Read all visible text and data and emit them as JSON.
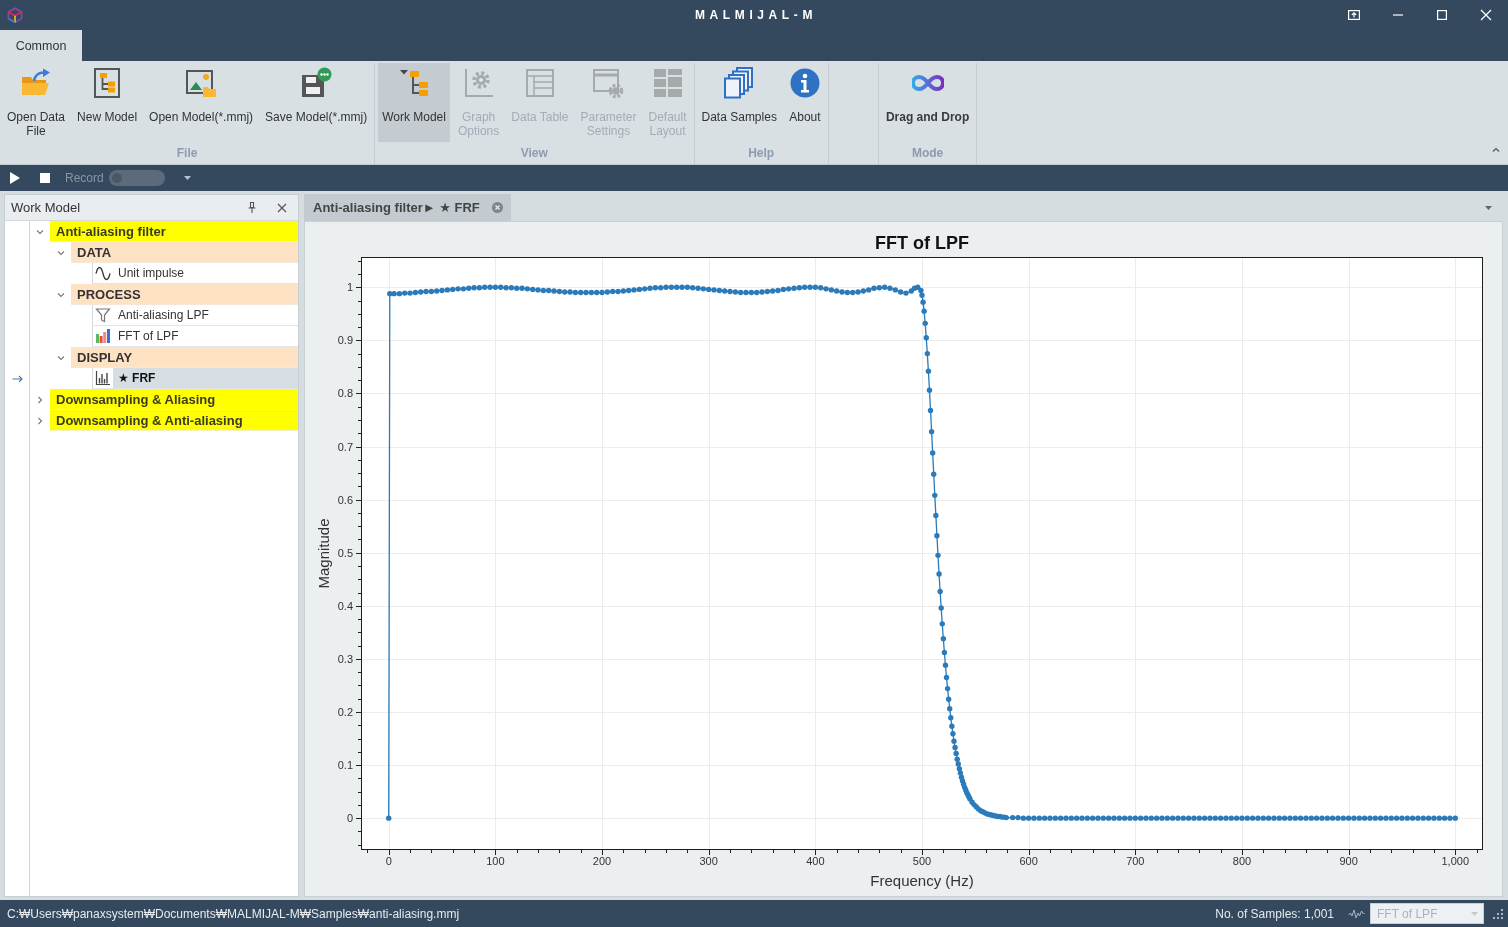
{
  "window": {
    "title": "MALMIJAL-M"
  },
  "ribbon": {
    "tabs": [
      {
        "label": "Common",
        "selected": true
      }
    ],
    "groups": [
      {
        "label": "File",
        "buttons": [
          {
            "label": "Open Data\nFile",
            "kind": "command",
            "on": false,
            "disabled": false
          },
          {
            "label": "New Model",
            "kind": "command",
            "on": false,
            "disabled": false
          },
          {
            "label": "Open Model(*.mmj)",
            "kind": "command",
            "on": false,
            "disabled": false
          },
          {
            "label": "Save Model(*.mmj)",
            "kind": "command",
            "on": false,
            "disabled": false
          }
        ]
      },
      {
        "label": "View",
        "buttons": [
          {
            "label": "Work Model",
            "kind": "command",
            "on": true,
            "disabled": false
          },
          {
            "label": "Graph\nOptions",
            "kind": "command",
            "on": false,
            "disabled": true
          },
          {
            "label": "Data Table",
            "kind": "command",
            "on": false,
            "disabled": true
          },
          {
            "label": "Parameter\nSettings",
            "kind": "command",
            "on": false,
            "disabled": true
          },
          {
            "label": "Default\nLayout",
            "kind": "command",
            "on": false,
            "disabled": true
          }
        ]
      },
      {
        "label": "Help",
        "buttons": [
          {
            "label": "Data Samples",
            "kind": "command",
            "on": false,
            "disabled": false
          },
          {
            "label": "About",
            "kind": "command",
            "on": false,
            "disabled": false
          }
        ]
      },
      {
        "label": "Mode",
        "buttons": [
          {
            "label": "Drag and Drop",
            "kind": "mode",
            "on": false,
            "disabled": false
          }
        ]
      }
    ]
  },
  "toolbar": {
    "record": {
      "label": "Record",
      "disabled": true,
      "on": false
    }
  },
  "work_model": {
    "title": "Work Model",
    "tree": [
      {
        "label": "Anti-aliasing filter",
        "kind": "model",
        "expanded": true,
        "selected": false,
        "children": [
          {
            "label": "DATA",
            "kind": "category",
            "expanded": true,
            "selected": false,
            "children": [
              {
                "label": "Unit impulse",
                "kind": "signal",
                "selected": false
              }
            ]
          },
          {
            "label": "PROCESS",
            "kind": "category",
            "expanded": true,
            "selected": false,
            "children": [
              {
                "label": "Anti-aliasing LPF",
                "kind": "filter",
                "selected": false
              },
              {
                "label": "FFT of LPF",
                "kind": "spectrum",
                "selected": false
              }
            ]
          },
          {
            "label": "DISPLAY",
            "kind": "category",
            "expanded": true,
            "selected": false,
            "children": [
              {
                "label": "★ FRF",
                "kind": "plot",
                "selected": true
              }
            ]
          }
        ]
      },
      {
        "label": "Downsampling & Aliasing",
        "kind": "model",
        "expanded": false,
        "selected": false
      },
      {
        "label": "Downsampling & Anti-aliasing",
        "kind": "model",
        "expanded": false,
        "selected": false
      }
    ]
  },
  "document": {
    "tabs": [
      {
        "label": "Anti-aliasing filter► ★ FRF",
        "selected": true
      }
    ],
    "chart_data": {
      "type": "line",
      "title": "FFT of LPF",
      "xlabel": "Frequency (Hz)",
      "ylabel": "Magnitude",
      "xlim": [
        -26,
        1026
      ],
      "ylim": [
        -0.06,
        1.057
      ],
      "grid": true,
      "xticks": [
        0,
        100,
        200,
        300,
        400,
        500,
        600,
        700,
        800,
        900,
        {
          "value": 1000,
          "label": "1,000"
        }
      ],
      "yticks": [
        0,
        0.1,
        0.2,
        0.3,
        0.4,
        0.5,
        0.6,
        0.7,
        0.8,
        0.9,
        1
      ],
      "x": [
        0,
        1,
        5,
        10,
        15,
        20,
        25,
        30,
        35,
        40,
        45,
        50,
        55,
        60,
        65,
        70,
        75,
        80,
        85,
        90,
        95,
        100,
        105,
        110,
        115,
        120,
        125,
        130,
        135,
        140,
        145,
        150,
        155,
        160,
        165,
        170,
        175,
        180,
        185,
        190,
        195,
        200,
        205,
        210,
        215,
        220,
        225,
        230,
        235,
        240,
        245,
        250,
        255,
        260,
        265,
        270,
        275,
        280,
        285,
        290,
        295,
        300,
        305,
        310,
        315,
        320,
        325,
        330,
        335,
        340,
        345,
        350,
        355,
        360,
        365,
        370,
        375,
        380,
        385,
        390,
        395,
        400,
        405,
        410,
        415,
        420,
        425,
        430,
        435,
        440,
        445,
        450,
        455,
        460,
        465,
        470,
        475,
        480,
        485,
        490,
        493,
        496,
        499,
        500,
        501,
        502,
        503,
        504,
        505,
        506,
        507,
        508,
        509,
        510,
        511,
        512,
        513,
        514,
        515,
        516,
        517,
        518,
        519,
        520,
        521,
        522,
        523,
        524,
        525,
        526,
        527,
        528,
        529,
        530,
        531,
        532,
        533,
        534,
        535,
        536,
        537,
        538,
        539,
        540,
        541,
        542,
        543,
        544,
        545,
        547,
        549,
        551,
        553,
        555,
        557,
        559,
        561,
        563,
        565,
        567,
        569,
        571,
        573,
        575,
        577,
        579,
        585,
        590,
        595,
        600,
        605,
        610,
        615,
        620,
        625,
        630,
        635,
        640,
        645,
        650,
        655,
        660,
        665,
        670,
        675,
        680,
        685,
        690,
        695,
        700,
        705,
        710,
        715,
        720,
        725,
        730,
        735,
        740,
        745,
        750,
        755,
        760,
        765,
        770,
        775,
        780,
        785,
        790,
        795,
        800,
        805,
        810,
        815,
        820,
        825,
        830,
        835,
        840,
        845,
        850,
        855,
        860,
        865,
        870,
        875,
        880,
        885,
        890,
        895,
        900,
        905,
        910,
        915,
        920,
        925,
        930,
        935,
        940,
        945,
        950,
        955,
        960,
        965,
        970,
        975,
        980,
        985,
        990,
        995,
        1000
      ],
      "values": [
        0,
        0.988,
        0.988,
        0.988,
        0.989,
        0.989,
        0.99,
        0.991,
        0.992,
        0.992,
        0.993,
        0.994,
        0.995,
        0.996,
        0.997,
        0.997,
        0.998,
        0.999,
        0.999,
        1,
        1,
        1,
        1,
        0.999,
        0.999,
        0.998,
        0.998,
        0.997,
        0.996,
        0.995,
        0.994,
        0.994,
        0.993,
        0.992,
        0.991,
        0.991,
        0.99,
        0.99,
        0.99,
        0.99,
        0.99,
        0.99,
        0.991,
        0.992,
        0.992,
        0.993,
        0.994,
        0.995,
        0.996,
        0.997,
        0.998,
        0.999,
        0.999,
        1,
        1,
        1,
        1,
        1,
        0.999,
        0.998,
        0.997,
        0.996,
        0.995,
        0.994,
        0.993,
        0.992,
        0.991,
        0.99,
        0.99,
        0.99,
        0.99,
        0.991,
        0.992,
        0.993,
        0.994,
        0.996,
        0.997,
        0.998,
        0.999,
        1,
        1,
        1,
        0.999,
        0.997,
        0.995,
        0.993,
        0.991,
        0.99,
        0.99,
        0.991,
        0.993,
        0.995,
        0.998,
        0.999,
        1,
        0.998,
        0.995,
        0.991,
        0.989,
        0.993,
        0.998,
        1,
        0.994,
        0.985,
        0.972,
        0.955,
        0.932,
        0.905,
        0.875,
        0.842,
        0.806,
        0.768,
        0.728,
        0.688,
        0.648,
        0.608,
        0.57,
        0.532,
        0.495,
        0.46,
        0.427,
        0.396,
        0.366,
        0.338,
        0.312,
        0.288,
        0.265,
        0.244,
        0.224,
        0.206,
        0.189,
        0.173,
        0.159,
        0.145,
        0.133,
        0.122,
        0.111,
        0.102,
        0.093,
        0.085,
        0.077,
        0.07,
        0.064,
        0.058,
        0.053,
        0.048,
        0.044,
        0.04,
        0.036,
        0.03,
        0.025,
        0.021,
        0.017,
        0.014,
        0.012,
        0.01,
        0.008,
        0.007,
        0.006,
        0.005,
        0.004,
        0.003,
        0.003,
        0.002,
        0.002,
        0.001,
        0.001,
        0.001,
        0,
        0,
        0,
        0,
        0,
        0,
        0,
        0,
        0,
        0,
        0,
        0,
        0,
        0,
        0,
        0,
        0,
        0,
        0,
        0,
        0,
        0,
        0,
        0,
        0,
        0,
        0,
        0,
        0,
        0,
        0,
        0,
        0,
        0,
        0,
        0,
        0,
        0,
        0,
        0,
        0,
        0,
        0,
        0,
        0,
        0,
        0,
        0,
        0,
        0,
        0,
        0,
        0,
        0,
        0,
        0,
        0,
        0,
        0,
        0,
        0,
        0,
        0,
        0,
        0,
        0,
        0,
        0,
        0,
        0,
        0,
        0,
        0,
        0,
        0,
        0,
        0,
        0,
        0,
        0,
        0,
        0
      ]
    }
  },
  "status_bar": {
    "path": "C:₩Users₩panaxsystem₩Documents₩MALMIJAL-M₩Samples₩anti-aliasing.mmj",
    "sample_count": "No. of Samples: 1,001",
    "chart_select": {
      "value": "FFT of LPF",
      "disabled": true
    }
  }
}
